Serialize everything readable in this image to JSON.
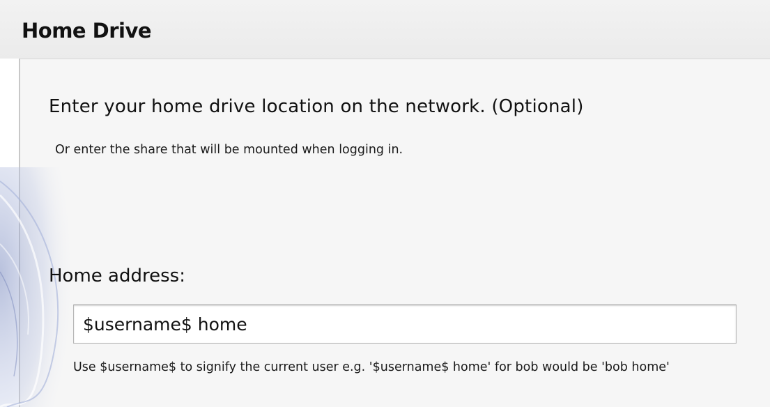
{
  "header": {
    "title": "Home Drive"
  },
  "main": {
    "heading": "Enter your home drive location on the network. (Optional)",
    "subheading": "Or enter the share that will be mounted when logging in.",
    "home_address": {
      "label": "Home address:",
      "value": "$username$ home",
      "hint": "Use $username$ to signify the current user e.g. '$username$ home' for bob would be 'bob home'"
    },
    "decoration_icon": "globe-swirl-icon"
  },
  "colors": {
    "header_bg": "#efefef",
    "panel_bg": "#f6f6f6",
    "text": "#111111",
    "decor_tint": "#8f9ec8"
  }
}
